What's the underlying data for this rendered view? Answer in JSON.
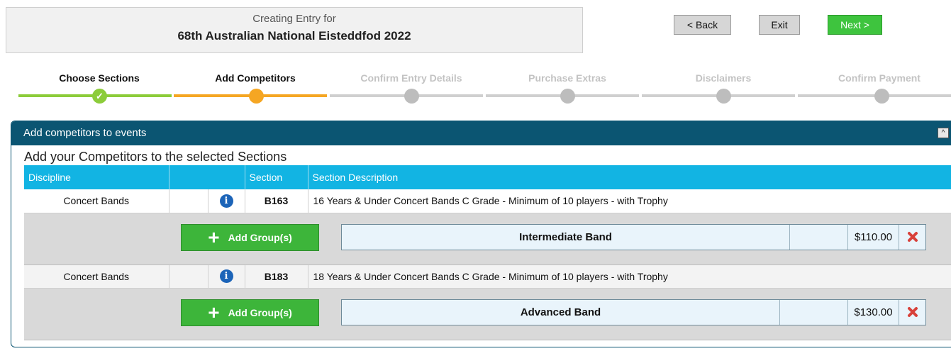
{
  "header": {
    "subtitle": "Creating Entry for",
    "title": "68th Australian National Eisteddfod 2022"
  },
  "nav": {
    "back": "< Back",
    "exit": "Exit",
    "next": "Next >"
  },
  "steps": [
    {
      "label": "Choose Sections",
      "state": "done",
      "mark": "✓"
    },
    {
      "label": "Add Competitors",
      "state": "active",
      "mark": ""
    },
    {
      "label": "Confirm Entry Details",
      "state": "pending",
      "mark": ""
    },
    {
      "label": "Purchase Extras",
      "state": "pending",
      "mark": ""
    },
    {
      "label": "Disclaimers",
      "state": "pending",
      "mark": ""
    },
    {
      "label": "Confirm Payment",
      "state": "pending",
      "mark": ""
    }
  ],
  "panel": {
    "title": "Add competitors to events",
    "collapse_icon": "^",
    "subtitle": "Add your Competitors to the selected Sections"
  },
  "table": {
    "headers": {
      "discipline": "Discipline",
      "section": "Section",
      "description": "Section Description"
    },
    "info_glyph": "i",
    "add_button": "Add Group(s)",
    "rows": [
      {
        "discipline": "Concert Bands",
        "section": "B163",
        "description": "16 Years & Under Concert Bands C Grade - Minimum of 10 players - with Trophy",
        "group": "Intermediate Band",
        "price": "$110.00"
      },
      {
        "discipline": "Concert Bands",
        "section": "B183",
        "description": "18 Years & Under Concert Bands C Grade - Minimum of 10 players - with Trophy",
        "group": "Advanced Band",
        "price": "$130.00"
      }
    ]
  },
  "colors": {
    "panel_header": "#0b5572",
    "table_header": "#12b4e3",
    "step_done": "#8ccc3a",
    "step_active": "#f5a623",
    "next_button": "#3ec43e",
    "delete_icon": "#d8413a"
  },
  "icons": {
    "step_done": "check-icon",
    "info": "info-icon",
    "add": "plus-icon",
    "delete": "delete-x-icon",
    "collapse": "collapse-icon"
  }
}
